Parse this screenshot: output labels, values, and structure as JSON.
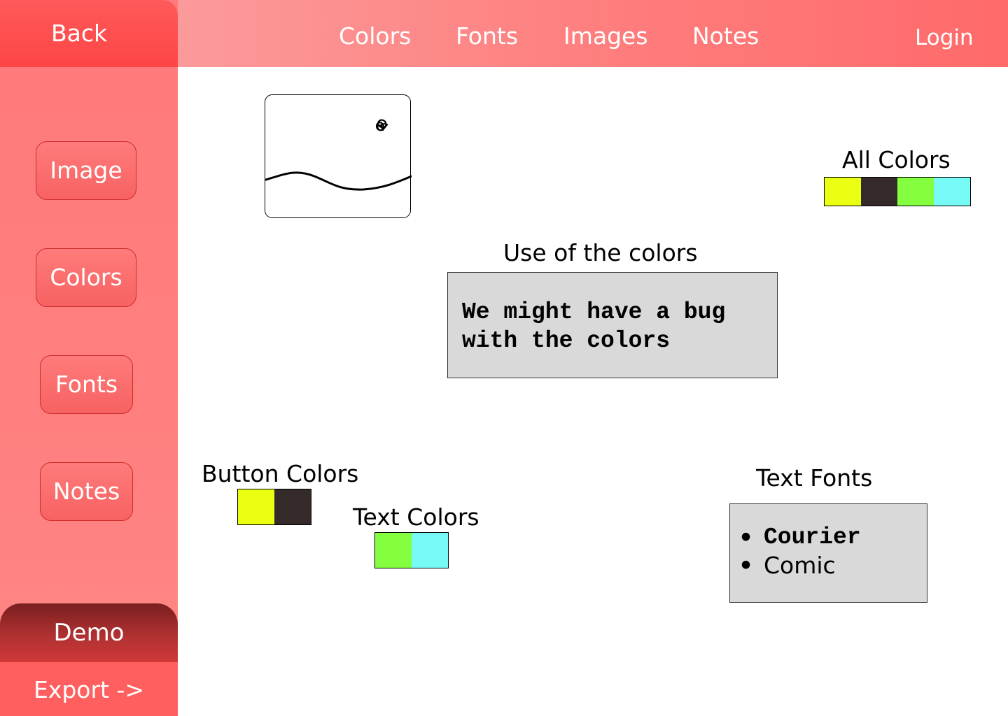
{
  "topnav": {
    "items": [
      {
        "label": "Colors"
      },
      {
        "label": "Fonts"
      },
      {
        "label": "Images"
      },
      {
        "label": "Notes"
      }
    ],
    "login_label": "Login"
  },
  "sidebar": {
    "back_label": "Back",
    "items": [
      {
        "label": "Image"
      },
      {
        "label": "Colors"
      },
      {
        "label": "Fonts"
      },
      {
        "label": "Notes"
      }
    ],
    "demo_label": "Demo",
    "export_label": "Export ->"
  },
  "main": {
    "image_placeholder_icon": "landscape-sketch-icon",
    "all_colors": {
      "title": "All Colors",
      "swatches": [
        "#eaff12",
        "#352a2a",
        "#83ff3f",
        "#77f9f5"
      ]
    },
    "usage": {
      "title": "Use of the colors",
      "text_line1": "We might have a bug",
      "text_line2": "with the colors"
    },
    "button_colors": {
      "title": "Button Colors",
      "swatches": [
        "#eaff12",
        "#352a2a"
      ]
    },
    "text_colors": {
      "title": "Text Colors",
      "swatches": [
        "#83ff3f",
        "#77f9f5"
      ]
    },
    "text_fonts": {
      "title": "Text Fonts",
      "items": [
        "Courier",
        "Comic"
      ]
    }
  }
}
